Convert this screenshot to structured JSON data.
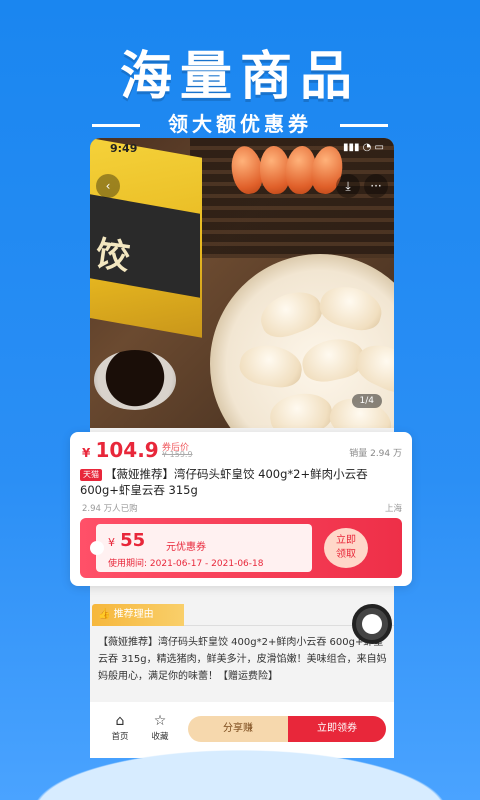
{
  "promo": {
    "headline": "海量商品",
    "subheadline": "领大额优惠券"
  },
  "status_bar": {
    "time": "9:49"
  },
  "gallery": {
    "pager": "1/4",
    "pack_text": "饺"
  },
  "product": {
    "currency": "¥",
    "price": "104.9",
    "price_note": "券后价",
    "original_price": "¥ 159.9",
    "sales": "销量 2.94 万",
    "platform_badge": "天猫",
    "title": "【薇娅推荐】湾仔码头虾皇饺 400g*2+鲜肉小云吞 600g+虾皇云吞 315g",
    "bought": "2.94 万人已购",
    "location": "上海"
  },
  "coupon": {
    "currency": "¥",
    "amount": "55",
    "label": "元优惠券",
    "validity": "使用期间: 2021-06-17 - 2021-06-18",
    "button_line1": "立即",
    "button_line2": "领取"
  },
  "reason": {
    "tab_label": "推荐理由",
    "text": "【薇娅推荐】湾仔码头虾皇饺 400g*2+鲜肉小云吞 600g+虾皇云吞 315g，精选猪肉，鲜美多汁，皮滑馅嫩！美味组合，来自妈妈般用心，满足你的味蕾！【赠运费险】"
  },
  "bottom_bar": {
    "home": "首页",
    "favorite": "收藏",
    "share": "分享赚",
    "get_coupon": "立即领券"
  },
  "colors": {
    "brand_blue": "#1a86f0",
    "accent_red": "#e8273a",
    "share_gold": "#f6d8ad"
  }
}
